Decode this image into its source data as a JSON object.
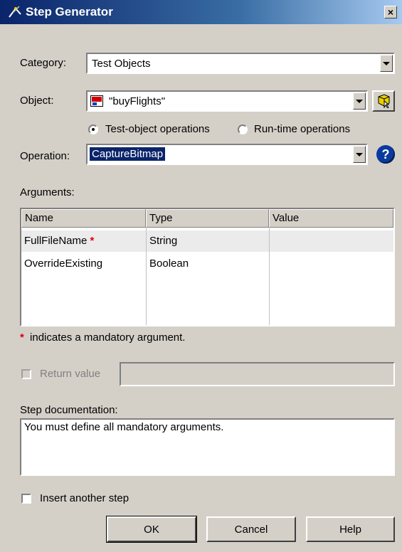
{
  "window": {
    "title": "Step Generator",
    "close_glyph": "×"
  },
  "category": {
    "label": "Category:",
    "value": "Test Objects"
  },
  "object": {
    "label": "Object:",
    "value": "\"buyFlights\""
  },
  "operation_mode": {
    "test_object": "Test-object operations",
    "run_time": "Run-time operations",
    "selected": "test_object"
  },
  "operation": {
    "label": "Operation:",
    "value": "CaptureBitmap",
    "help_glyph": "?"
  },
  "arguments": {
    "label": "Arguments:",
    "columns": [
      "Name",
      "Type",
      "Value"
    ],
    "rows": [
      {
        "name": "FullFileName",
        "mandatory_mark": "*",
        "type": "String",
        "value": ""
      },
      {
        "name": "OverrideExisting",
        "mandatory_mark": "",
        "type": "Boolean",
        "value": ""
      }
    ]
  },
  "mandatory_note": {
    "star": "*",
    "text": "indicates a mandatory argument."
  },
  "return_value": {
    "label": "Return value",
    "checked": false,
    "enabled": false,
    "value": ""
  },
  "step_doc": {
    "label": "Step documentation:",
    "text": "You must define all mandatory arguments."
  },
  "insert_another": {
    "label": "Insert another step",
    "checked": false
  },
  "buttons": {
    "ok": "OK",
    "cancel": "Cancel",
    "help": "Help"
  },
  "colors": {
    "dialog_bg": "#d4d0c8",
    "selection": "#0a246a",
    "title_start": "#0a246a",
    "title_end": "#a6caf0",
    "mandatory": "#e00000"
  }
}
